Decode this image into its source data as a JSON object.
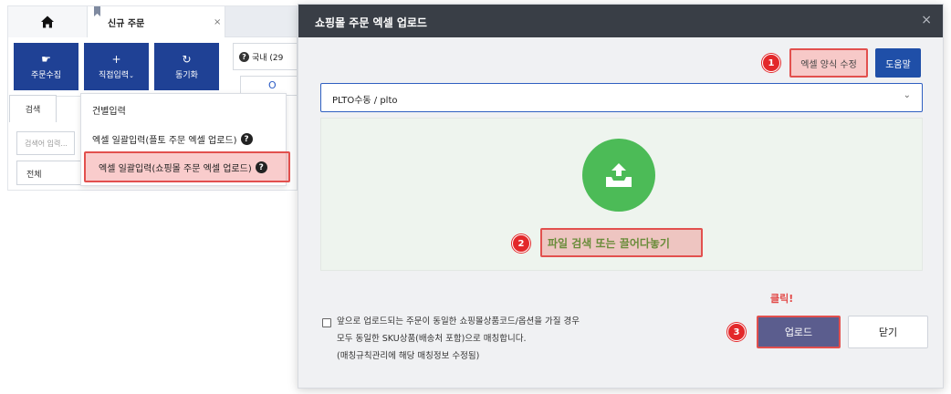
{
  "app": {
    "tab_label": "신규 주문",
    "tab_close": "×",
    "toolbar": {
      "collect_label": "주문수집",
      "direct_label": "직접입력",
      "direct_chevron": "⌄",
      "sync_label": "동기화"
    },
    "domestic_label": "국내 (29",
    "search_tab": "검색",
    "search_placeholder": "검색어 입력...",
    "all_select": "전체",
    "dropdown": {
      "items": [
        {
          "label": "건별입력"
        },
        {
          "label": "엑셀 일괄입력(플토 주문 엑셀 업로드)"
        },
        {
          "label": "엑셀 일괄입력(쇼핑몰 주문 엑셀 업로드)"
        }
      ]
    }
  },
  "modal": {
    "title": "쇼핑몰 주문 엑셀 업로드",
    "close": "×",
    "excel_format_button": "엑셀 양식 수정",
    "help_button": "도움말",
    "select_value": "PLTO수동 / plto",
    "select_chevron": "⌄",
    "dropzone_text": "파일 검색 또는 끌어다놓기",
    "footer_lines": [
      "앞으로 업로드되는 주문이 동일한 쇼핑몰상품코드/옵션을 가질 경우",
      "모두 동일한 SKU상품(배송처 포함)으로 매칭합니다.",
      "(매칭규칙관리에 해당 매칭정보 수정됨)"
    ],
    "click_label": "클릭!",
    "upload_button": "업로드",
    "close_button": "닫기"
  },
  "badges": [
    "1",
    "2",
    "3"
  ],
  "colors": {
    "primary_blue": "#1f4195",
    "highlight_red": "#e2504e",
    "upload_green": "#4cbb57",
    "upload_purple": "#5b5d8e",
    "modal_header": "#393e46"
  }
}
